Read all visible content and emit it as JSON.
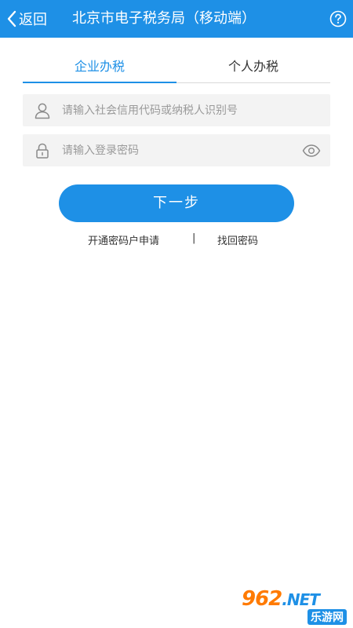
{
  "colors": {
    "primary": "#1e90e6",
    "field_bg": "#f3f3f3",
    "placeholder": "#9a9a9a"
  },
  "header": {
    "back_label": "返回",
    "title": "北京市电子税务局（移动端）",
    "back_icon": "chevron-left-icon",
    "help_icon": "question-circle-icon"
  },
  "tabs": [
    {
      "label": "企业办税",
      "active": true
    },
    {
      "label": "个人办税",
      "active": false
    }
  ],
  "form": {
    "id_field": {
      "placeholder": "请输入社会信用代码或纳税人识别号",
      "value": "",
      "icon": "user-icon"
    },
    "password_field": {
      "placeholder": "请输入登录密码",
      "value": "",
      "icon": "lock-icon",
      "toggle_icon": "eye-icon"
    },
    "next_label": "下一步"
  },
  "links": {
    "register": "开通密码户申请",
    "separator": "|",
    "forgot": "找回密码"
  },
  "watermark": {
    "logo": "962",
    "net": ".NET",
    "sub": "乐游网"
  }
}
